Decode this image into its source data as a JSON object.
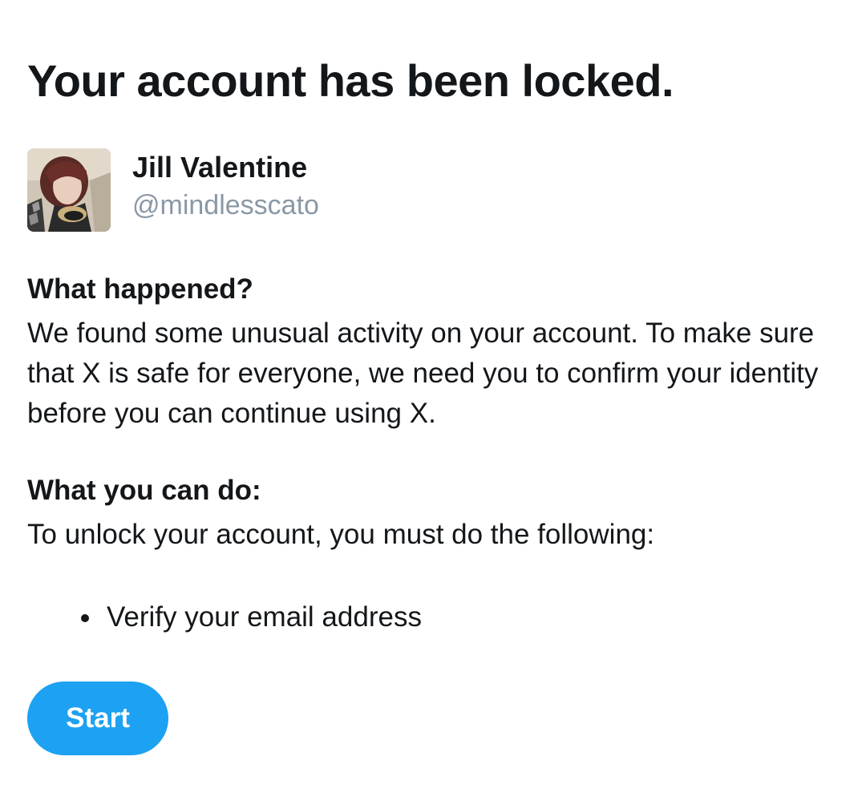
{
  "page": {
    "title": "Your account has been locked."
  },
  "profile": {
    "display_name": "Jill Valentine",
    "handle": "@mindlesscato",
    "avatar_icon": "user-photo"
  },
  "sections": [
    {
      "heading": "What happened?",
      "body": "We found some unusual activity on your account. To make sure that X is safe for everyone, we need you to confirm your identity before you can continue using X."
    },
    {
      "heading": "What you can do:",
      "body": "To unlock your account, you must do the following:"
    }
  ],
  "requirements": [
    "Verify your email address"
  ],
  "actions": {
    "start_label": "Start"
  },
  "colors": {
    "text": "#14171a",
    "handle": "#8a98a6",
    "accent": "#1da1f2",
    "background": "#ffffff"
  }
}
